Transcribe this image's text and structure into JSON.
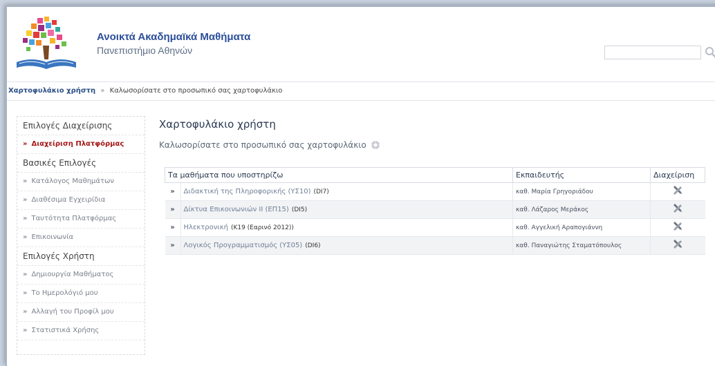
{
  "header": {
    "site_title": "Ανοικτά Ακαδημαϊκά Μαθήματα",
    "site_subtitle": "Πανεπιστήμιο Αθηνών",
    "search_placeholder": ""
  },
  "breadcrumb": {
    "root": "Χαρτοφυλάκιο χρήστη",
    "separator": "»",
    "current": "Καλωσορίσατε στο προσωπικό σας χαρτοφυλάκιο"
  },
  "sidebar": {
    "sections": [
      {
        "title": "Επιλογές Διαχείρισης",
        "items": [
          {
            "label": "Διαχείριση Πλατφόρμας",
            "active": true
          }
        ]
      },
      {
        "title": "Βασικές Επιλογές",
        "items": [
          {
            "label": "Κατάλογος Μαθημάτων",
            "active": false
          },
          {
            "label": "Διαθέσιμα Εγχειρίδια",
            "active": false
          },
          {
            "label": "Ταυτότητα Πλατφόρμας",
            "active": false
          },
          {
            "label": "Επικοινωνία",
            "active": false
          }
        ]
      },
      {
        "title": "Επιλογές Χρήστη",
        "items": [
          {
            "label": "Δημιουργία Μαθήματος",
            "active": false
          },
          {
            "label": "Το Ημερολόγιό μου",
            "active": false
          },
          {
            "label": "Αλλαγή του Προφίλ μου",
            "active": false
          },
          {
            "label": "Στατιστικά Χρήσης",
            "active": false
          }
        ]
      }
    ],
    "bullet": "»"
  },
  "main": {
    "title": "Χαρτοφυλάκιο χρήστη",
    "welcome": "Καλωσορίσατε στο προσωπικό σας χαρτοφυλάκιο",
    "table": {
      "headers": {
        "course": "Τα μαθήματα που υποστηρίζω",
        "instructor": "Εκπαιδευτής",
        "admin": "Διαχείριση"
      },
      "rows": [
        {
          "name": "Διδακτική της Πληροφορικής (ΥΣ10)",
          "code": "(DI7)",
          "instructor": "καθ. Μαρία Γρηγοριάδου"
        },
        {
          "name": "Δίκτυα Επικοινωνιών II (ΕΠ15)",
          "code": "(DI5)",
          "instructor": "καθ. Λάζαρος Μεράκος"
        },
        {
          "name": "Ηλεκτρονική",
          "code": "(K19 (Εαρινό 2012))",
          "instructor": "καθ. Αγγελική Αραπογιάννη"
        },
        {
          "name": "Λογικός Προγραμματισμός (ΥΣ05)",
          "code": "(DI6)",
          "instructor": "καθ. Παναγιώτης Σταματόπουλος"
        }
      ]
    }
  },
  "colors": {
    "brand_blue": "#2c4e9a",
    "active_red": "#a31616"
  }
}
